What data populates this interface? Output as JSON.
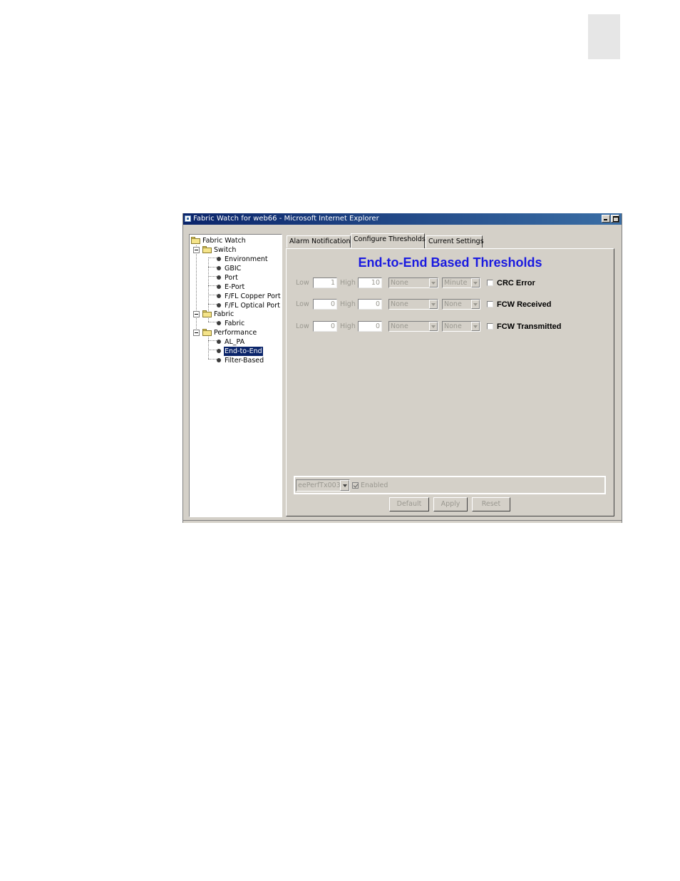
{
  "window": {
    "title": "Fabric Watch for web66 - Microsoft Internet Explorer"
  },
  "tree": {
    "root": "Fabric Watch",
    "switch": "Switch",
    "switch_items": [
      "Environment",
      "GBIC",
      "Port",
      "E-Port",
      "F/FL Copper Port",
      "F/FL Optical Port"
    ],
    "fabric": "Fabric",
    "fabric_items": [
      "Fabric"
    ],
    "performance": "Performance",
    "performance_items": [
      "AL_PA",
      "End-to-End",
      "Filter-Based"
    ],
    "selected": "End-to-End"
  },
  "tabs": [
    {
      "label": "Alarm Notifications"
    },
    {
      "label": "Configure Thresholds",
      "active": true
    },
    {
      "label": "Current Settings"
    }
  ],
  "panel": {
    "title": "End-to-End Based Thresholds",
    "low_label": "Low",
    "high_label": "High",
    "rows": [
      {
        "low": "1",
        "high": "10",
        "unit": "None",
        "time_base": "Minute",
        "name": "CRC Error"
      },
      {
        "low": "0",
        "high": "0",
        "unit": "None",
        "time_base": "None",
        "name": "FCW Received"
      },
      {
        "low": "0",
        "high": "0",
        "unit": "None",
        "time_base": "None",
        "name": "FCW Transmitted"
      }
    ],
    "sensor": "eePerfTx003",
    "enabled_label": "Enabled",
    "buttons": {
      "default": "Default",
      "apply": "Apply",
      "reset": "Reset"
    }
  }
}
